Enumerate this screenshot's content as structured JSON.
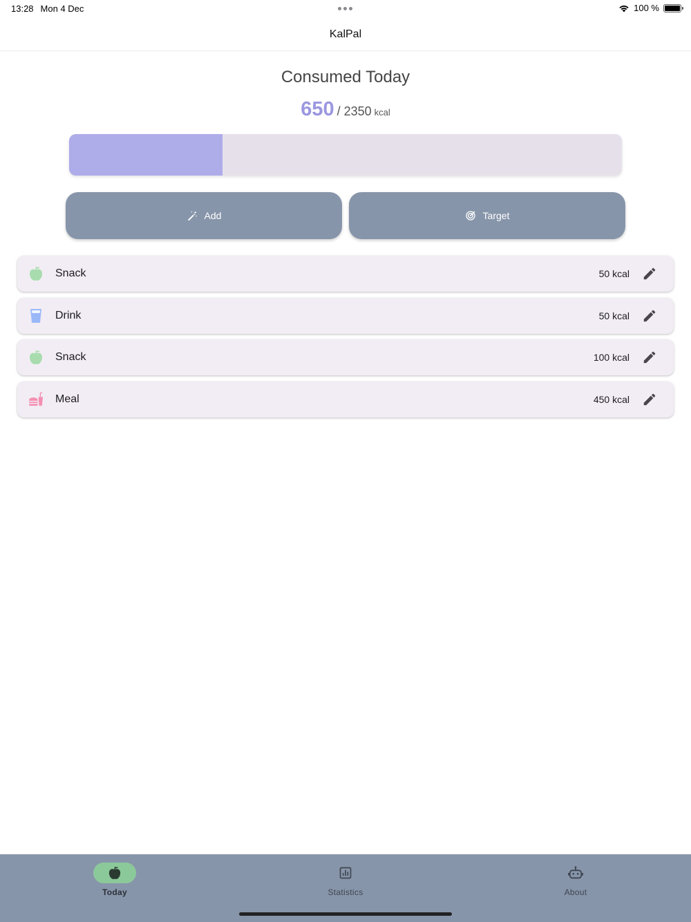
{
  "status": {
    "time": "13:28",
    "date": "Mon 4 Dec",
    "battery": "100 %",
    "icons": [
      "wifi-icon",
      "battery-icon"
    ]
  },
  "app": {
    "title": "KalPal"
  },
  "summary": {
    "heading": "Consumed Today",
    "consumed": "650",
    "target": "/ 2350",
    "unit": "kcal",
    "progress_fraction": 0.277
  },
  "actions": {
    "add_label": "Add",
    "target_label": "Target"
  },
  "entries": [
    {
      "label": "Snack",
      "kcal": "50 kcal",
      "icon": "apple-icon",
      "color": "#a8dcae"
    },
    {
      "label": "Drink",
      "kcal": "50 kcal",
      "icon": "glass-icon",
      "color": "#9ab8f8"
    },
    {
      "label": "Snack",
      "kcal": "100 kcal",
      "icon": "apple-icon",
      "color": "#a8dcae"
    },
    {
      "label": "Meal",
      "kcal": "450 kcal",
      "icon": "meal-icon",
      "color": "#f48fb1"
    }
  ],
  "nav": {
    "today": "Today",
    "statistics": "Statistics",
    "about": "About"
  },
  "colors": {
    "accent": "#9b97e0",
    "progress_fill": "#aeace9",
    "progress_track": "#e6e0eb",
    "button": "#8795aa",
    "nav_active": "#8cc99a"
  }
}
